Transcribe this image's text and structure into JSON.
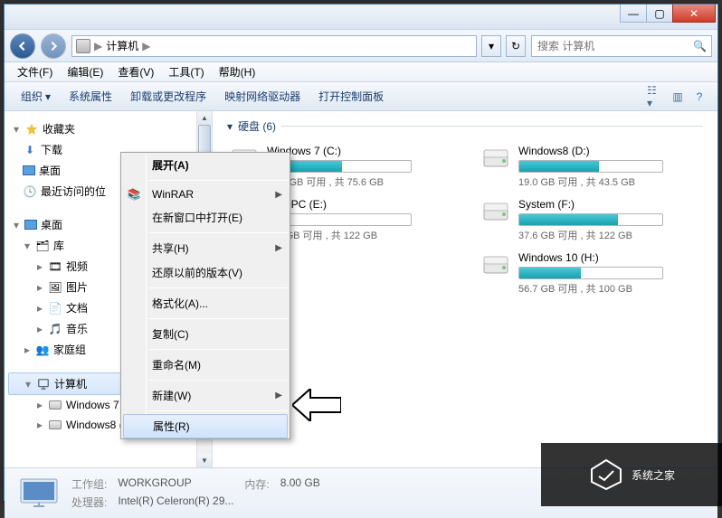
{
  "window": {
    "back": "←",
    "fwd": "→"
  },
  "address": {
    "computer": "计算机",
    "sep": "▶"
  },
  "search": {
    "placeholder": "搜索 计算机"
  },
  "menu": {
    "file": "文件(F)",
    "edit": "编辑(E)",
    "view": "查看(V)",
    "tools": "工具(T)",
    "help": "帮助(H)"
  },
  "toolbar": {
    "organize": "组织",
    "sysprops": "系统属性",
    "uninstall": "卸载或更改程序",
    "netdrv": "映射网络驱动器",
    "cpanel": "打开控制面板"
  },
  "nav": {
    "favorites": "收藏夹",
    "downloads": "下载",
    "desktop": "桌面",
    "recent": "最近访问的位",
    "desk2": "桌面",
    "libraries": "库",
    "videos": "视频",
    "pictures": "图片",
    "docs": "文档",
    "music": "音乐",
    "homegroup": "家庭组",
    "computer": "计算机",
    "win7": "Windows 7  (C:)",
    "win8": "Windows8 (D:)"
  },
  "section": {
    "drives_hdr": "硬盘 (6)"
  },
  "drives": [
    {
      "name": "Windows 7  (C:)",
      "free": "36.4 GB 可用 , 共 75.6 GB",
      "pct": 52
    },
    {
      "name": "Windows8 (D:)",
      "free": "19.0 GB 可用 , 共 43.5 GB",
      "pct": 56
    },
    {
      "name": "Thin PC (E:)",
      "free": "117 GB 可用 , 共 122 GB",
      "pct": 4
    },
    {
      "name": "System (F:)",
      "free": "37.6 GB 可用 , 共 122 GB",
      "pct": 69
    },
    {
      "name": "",
      "free": "",
      "pct": 0
    },
    {
      "name": "Windows 10 (H:)",
      "free": "56.7 GB 可用 , 共 100 GB",
      "pct": 43
    }
  ],
  "ctx": {
    "expand": "展开(A)",
    "winrar": "WinRAR",
    "newwin": "在新窗口中打开(E)",
    "share": "共享(H)",
    "restore": "还原以前的版本(V)",
    "format": "格式化(A)...",
    "copy": "复制(C)",
    "rename": "重命名(M)",
    "new": "新建(W)",
    "properties": "属性(R)"
  },
  "status": {
    "workgroup_k": "工作组:",
    "workgroup_v": "WORKGROUP",
    "mem_k": "内存:",
    "mem_v": "8.00 GB",
    "cpu_k": "处理器:",
    "cpu_v": "Intel(R) Celeron(R) 29..."
  },
  "watermark": "系统之家"
}
